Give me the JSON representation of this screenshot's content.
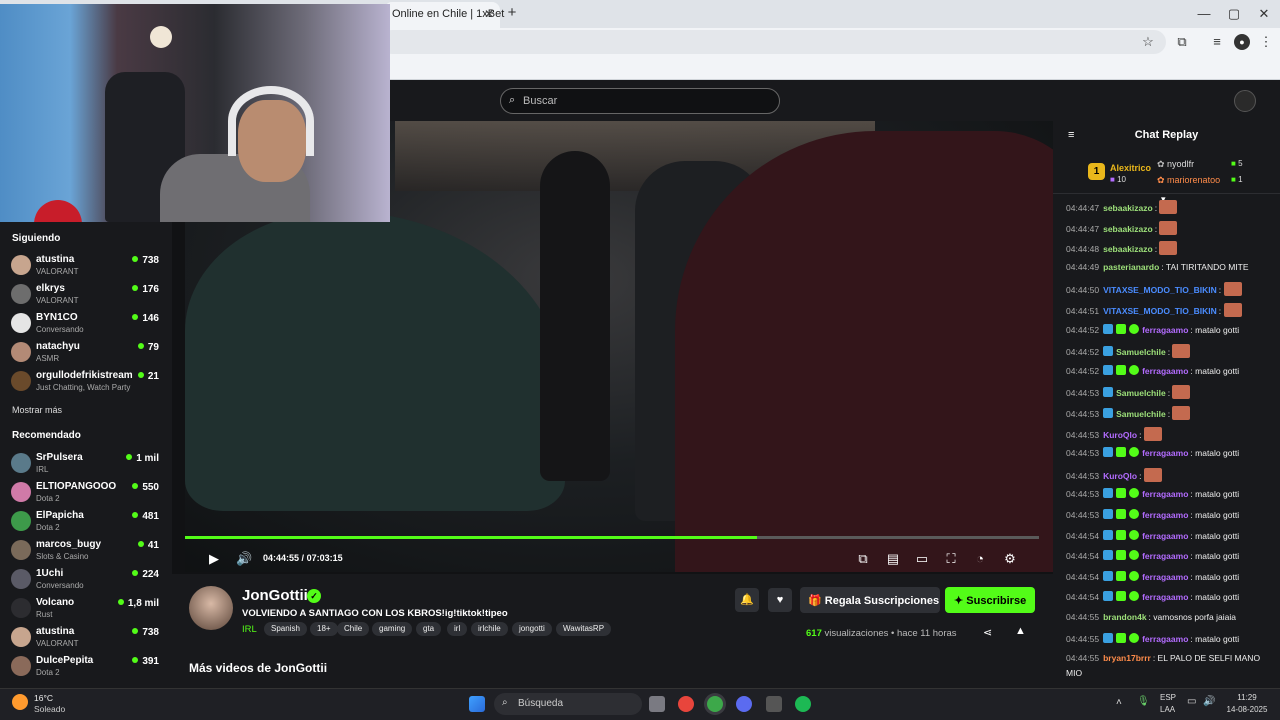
{
  "browser": {
    "tab_title": "Online en Chile | 1xBet",
    "new_tab": "+",
    "close": "✕",
    "minimize": "—",
    "maximize": "▢",
    "win_close": "✕"
  },
  "header": {
    "search_placeholder": "Buscar"
  },
  "sidebar": {
    "following_title": "Siguiendo",
    "following": [
      {
        "name": "atustina",
        "category": "VALORANT",
        "viewers": "738",
        "color": "#c7a58e"
      },
      {
        "name": "elkrys",
        "category": "VALORANT",
        "viewers": "176",
        "color": "#6d6d6d"
      },
      {
        "name": "BYN1CO",
        "category": "Conversando",
        "viewers": "146",
        "color": "#e5e5e5"
      },
      {
        "name": "natachyu",
        "category": "ASMR",
        "viewers": "79",
        "color": "#b38a76"
      },
      {
        "name": "orgullodefrikistream",
        "category": "Just Chatting, Watch Party",
        "viewers": "21",
        "color": "#6a4a2b"
      }
    ],
    "show_more": "Mostrar más",
    "recommended_title": "Recomendado",
    "recommended": [
      {
        "name": "SrPulsera",
        "category": "IRL",
        "viewers": "1 mil",
        "color": "#5a7a8a"
      },
      {
        "name": "ELTIOPANGOOO",
        "category": "Dota 2",
        "viewers": "550",
        "color": "#d07aa8"
      },
      {
        "name": "ElPapicha",
        "category": "Dota 2",
        "viewers": "481",
        "color": "#3d9a4a"
      },
      {
        "name": "marcos_bugy",
        "category": "Slots & Casino",
        "viewers": "41",
        "color": "#7a6a5a"
      },
      {
        "name": "1Uchi",
        "category": "Conversando",
        "viewers": "224",
        "color": "#5a5a66"
      },
      {
        "name": "Volcano",
        "category": "Rust",
        "viewers": "1,8 mil",
        "color": "#2c2c30"
      },
      {
        "name": "atustina",
        "category": "VALORANT",
        "viewers": "738",
        "color": "#c7a58e"
      },
      {
        "name": "DulcePepita",
        "category": "Dota 2",
        "viewers": "391",
        "color": "#8a6a5a"
      }
    ]
  },
  "player": {
    "current_time": "04:44:55",
    "duration": "07:03:15",
    "time_separator": "/",
    "progress": 0.67
  },
  "stream": {
    "channel": "JonGottii",
    "title": "VOLVIENDO A SANTIAGO CON LOS KBROS!ig!tiktok!tipeo",
    "category": "IRL",
    "tags": [
      "Spanish",
      "18+",
      "Chile",
      "gaming",
      "gta",
      "irl",
      "irlchile",
      "jongotti",
      "WawitasRP"
    ],
    "gift_label": "Regala Suscripciones",
    "subscribe_label": "Suscribirse",
    "views_count": "617",
    "views_label": "visualizaciones",
    "time_ago": "hace 11 horas",
    "more_videos": "Más videos de JonGottii"
  },
  "chat": {
    "title": "Chat Replay",
    "leaders": [
      {
        "rank": "1",
        "name": "Alexitrico",
        "count": "10"
      },
      {
        "name": "nyodlfr",
        "count": "5"
      },
      {
        "name": "mariorenatoo",
        "count": "1"
      }
    ],
    "messages": [
      {
        "time": "04:44:47",
        "user": "sebaakizazo",
        "color": "#9de07a",
        "text": "",
        "emote": true,
        "badges": 0
      },
      {
        "time": "04:44:47",
        "user": "sebaakizazo",
        "color": "#9de07a",
        "text": "",
        "emote": true,
        "badges": 0
      },
      {
        "time": "04:44:48",
        "user": "sebaakizazo",
        "color": "#9de07a",
        "text": "",
        "emote": true,
        "badges": 0
      },
      {
        "time": "04:44:49",
        "user": "pasterianardo",
        "color": "#9de07a",
        "text": "TAI TIRITANDO MITE",
        "emote": false,
        "badges": 0
      },
      {
        "time": "04:44:50",
        "user": "VITAXSE_MODO_TIO_BIKIN",
        "color": "#4a8cff",
        "text": "",
        "emote": true,
        "badges": 0
      },
      {
        "time": "04:44:51",
        "user": "VITAXSE_MODO_TIO_BIKIN",
        "color": "#4a8cff",
        "text": "",
        "emote": true,
        "badges": 0
      },
      {
        "time": "04:44:52",
        "user": "ferragaamo",
        "color": "#b36cff",
        "text": "matalo gotti",
        "emote": false,
        "badges": 3
      },
      {
        "time": "04:44:52",
        "user": "Samuelchile",
        "color": "#9de07a",
        "text": "",
        "emote": true,
        "badges": 1
      },
      {
        "time": "04:44:52",
        "user": "ferragaamo",
        "color": "#b36cff",
        "text": "matalo gotti",
        "emote": false,
        "badges": 3
      },
      {
        "time": "04:44:53",
        "user": "Samuelchile",
        "color": "#9de07a",
        "text": "",
        "emote": true,
        "badges": 1
      },
      {
        "time": "04:44:53",
        "user": "Samuelchile",
        "color": "#9de07a",
        "text": "",
        "emote": true,
        "badges": 1
      },
      {
        "time": "04:44:53",
        "user": "KuroQlo",
        "color": "#b36cff",
        "text": "",
        "emote": true,
        "badges": 0
      },
      {
        "time": "04:44:53",
        "user": "ferragaamo",
        "color": "#b36cff",
        "text": "matalo gotti",
        "emote": false,
        "badges": 3
      },
      {
        "time": "04:44:53",
        "user": "KuroQlo",
        "color": "#b36cff",
        "text": "",
        "emote": true,
        "badges": 0
      },
      {
        "time": "04:44:53",
        "user": "ferragaamo",
        "color": "#b36cff",
        "text": "matalo gotti",
        "emote": false,
        "badges": 3
      },
      {
        "time": "04:44:53",
        "user": "ferragaamo",
        "color": "#b36cff",
        "text": "matalo gotti",
        "emote": false,
        "badges": 3
      },
      {
        "time": "04:44:54",
        "user": "ferragaamo",
        "color": "#b36cff",
        "text": "matalo gotti",
        "emote": false,
        "badges": 3
      },
      {
        "time": "04:44:54",
        "user": "ferragaamo",
        "color": "#b36cff",
        "text": "matalo gotti",
        "emote": false,
        "badges": 3
      },
      {
        "time": "04:44:54",
        "user": "ferragaamo",
        "color": "#b36cff",
        "text": "matalo gotti",
        "emote": false,
        "badges": 3
      },
      {
        "time": "04:44:54",
        "user": "ferragaamo",
        "color": "#b36cff",
        "text": "matalo gotti",
        "emote": false,
        "badges": 3
      },
      {
        "time": "04:44:55",
        "user": "brandon4k",
        "color": "#9de07a",
        "text": "vamosnos porfa jaiaia",
        "emote": false,
        "badges": 0
      },
      {
        "time": "04:44:55",
        "user": "ferragaamo",
        "color": "#b36cff",
        "text": "matalo gotti",
        "emote": false,
        "badges": 3
      },
      {
        "time": "04:44:55",
        "user": "bryan17brrr",
        "color": "#ff8c4a",
        "text": "EL PALO DE SELFI MANO",
        "emote": false,
        "badges": 0
      }
    ],
    "last_continuation": "MIO"
  },
  "taskbar": {
    "weather_temp": "16°C",
    "weather_desc": "Soleado",
    "search_label": "Búsqueda",
    "lang_top": "ESP",
    "lang_bottom": "LAA",
    "clock_time": "11:29",
    "clock_date": "14-08-2025"
  },
  "colors": {
    "accent": "#53fc18"
  }
}
